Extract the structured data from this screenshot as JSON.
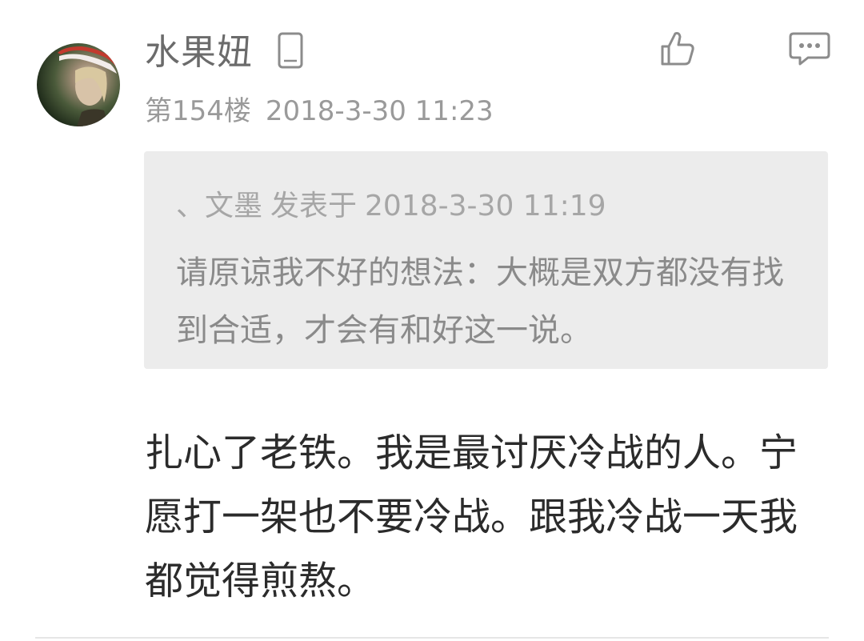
{
  "post": {
    "username": "水果妞",
    "floor": "第154楼",
    "timestamp": "2018-3-30 11:23",
    "quote": {
      "author": "、文墨",
      "posted_label": "发表于",
      "timestamp": "2018-3-30 11:19",
      "text": "请原谅我不好的想法：大概是双方都没有找到合适，才会有和好这一说。"
    },
    "content": "扎心了老铁。我是最讨厌冷战的人。宁愿打一架也不要冷战。跟我冷战一天我都觉得煎熬。"
  },
  "icons": {
    "device": "mobile-phone-icon",
    "like": "thumbs-up-icon",
    "comment": "comment-bubble-icon"
  },
  "colors": {
    "username": "#6b6b6b",
    "meta": "#9a9a9a",
    "quote_bg": "#ececec",
    "quote_text": "#8a8a8a",
    "body_text": "#2b2b2b"
  }
}
